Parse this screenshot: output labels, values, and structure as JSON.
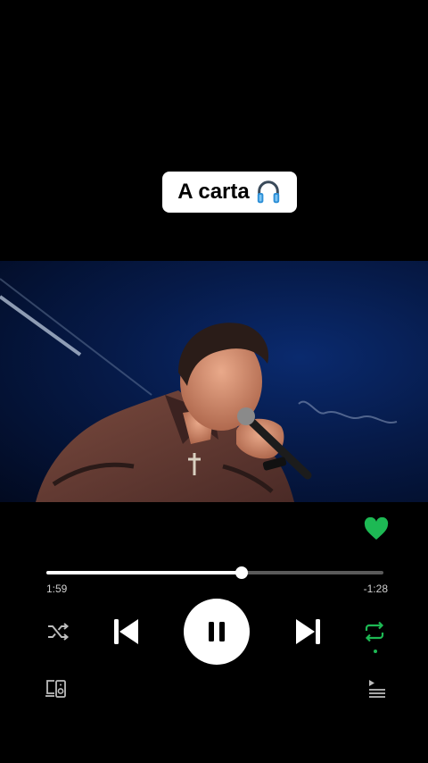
{
  "title": {
    "text": "A carta",
    "icon": "headphones-icon"
  },
  "video": {
    "description_icon": "video-frame"
  },
  "player": {
    "liked": true,
    "elapsed": "1:59",
    "remaining": "-1:28",
    "progress_fraction": 0.58,
    "state": "playing",
    "repeat_active": true,
    "colors": {
      "accent": "#1db954",
      "track": "#5a5a5a",
      "fill": "#ffffff"
    }
  },
  "controls": {
    "shuffle": "shuffle-icon",
    "previous": "skip-previous-icon",
    "play_pause": "pause-icon",
    "next": "skip-next-icon",
    "repeat": "repeat-icon",
    "devices": "connect-devices-icon",
    "queue": "queue-icon"
  }
}
